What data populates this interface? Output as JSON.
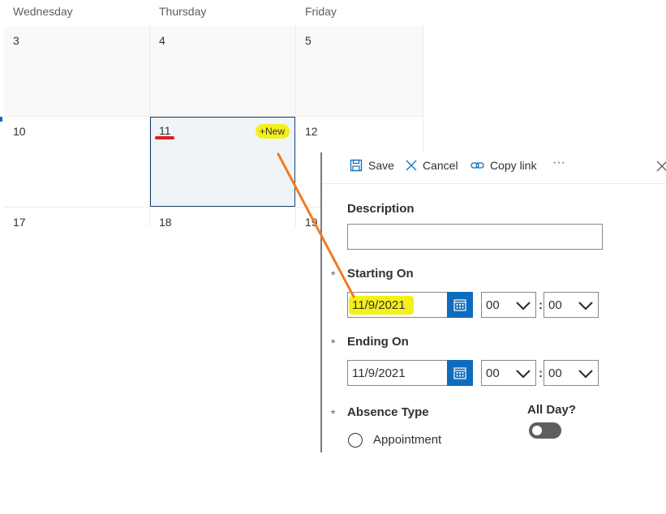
{
  "calendar": {
    "day_headers": [
      "Wednesday",
      "Thursday",
      "Friday"
    ],
    "days": [
      "3",
      "4",
      "5",
      "10",
      "11",
      "12",
      "17",
      "18",
      "19"
    ],
    "new_button_label": "+New"
  },
  "panel": {
    "toolbar": {
      "save_label": "Save",
      "cancel_label": "Cancel",
      "copy_link_label": "Copy link",
      "more_label": "···"
    },
    "description_label": "Description",
    "description_value": "",
    "required_marker": "*",
    "starting_on_label": "Starting On",
    "starting_date": "11/9/2021",
    "starting_hour": "00",
    "starting_minute": "00",
    "ending_on_label": "Ending On",
    "ending_date": "11/9/2021",
    "ending_hour": "00",
    "ending_minute": "00",
    "time_separator": ":",
    "absence_type_label": "Absence Type",
    "absence_option": "Appointment",
    "all_day_label": "All Day?",
    "all_day_value": false
  },
  "colors": {
    "accent": "#0f6cbd",
    "highlight": "#f4f01a",
    "annotation_line": "#f47a20",
    "annotation_underline": "#e01f1f"
  }
}
